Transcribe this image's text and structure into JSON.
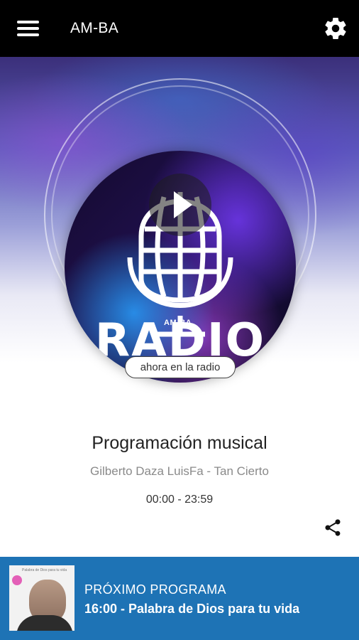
{
  "appbar": {
    "title": "AM-BA",
    "menu_icon": "menu-icon",
    "settings_icon": "gear-icon"
  },
  "hero": {
    "logo_text": "RADIO",
    "logo_badge": "AM-BA",
    "play_icon": "play-icon"
  },
  "now_playing": {
    "pill_label": "ahora en la radio",
    "program_title": "Programación musical",
    "track": "Gilberto Daza LuisFa - Tan Cierto",
    "time_range": "00:00 - 23:59",
    "share_icon": "share-icon"
  },
  "next_program": {
    "label": "PRÓXIMO PROGRAMA",
    "title": "16:00 - Palabra de Dios para tu vida",
    "thumb_caption": "Palabra de Dios para tu vida"
  },
  "colors": {
    "appbar": "#000000",
    "next_bar": "#1e73b5",
    "text_primary": "#222222",
    "text_secondary": "#8a8a8a"
  }
}
